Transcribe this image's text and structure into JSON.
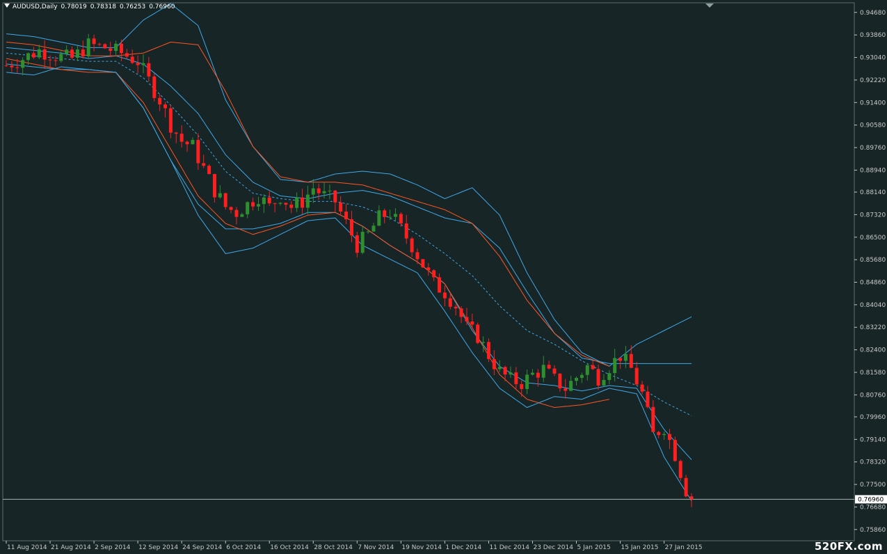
{
  "header": {
    "symbol": "AUDUSD,Daily",
    "open": "0.78019",
    "high": "0.78318",
    "low": "0.76253",
    "close": "0.76960"
  },
  "watermark": "520FX.com",
  "colors": {
    "background": "#172526",
    "bull_candle": "#2f8f2f",
    "bear_candle": "#ff1f1f",
    "inner_band": "#3fa9e8",
    "outer_band": "#ff5522",
    "midline": "#3fa9e8",
    "axis": "#c8c8c8",
    "price_line": "#aab4b4"
  },
  "chart_data": {
    "type": "candlestick",
    "symbol": "AUDUSD",
    "timeframe": "Daily",
    "ylim": [
      0.7545,
      0.9503
    ],
    "y_ticks": [
      "0.94680",
      "0.93860",
      "0.93040",
      "0.92220",
      "0.91400",
      "0.90580",
      "0.89760",
      "0.88940",
      "0.88140",
      "0.87320",
      "0.86500",
      "0.85680",
      "0.84860",
      "0.84040",
      "0.83220",
      "0.82400",
      "0.81580",
      "0.80760",
      "0.79960",
      "0.79140",
      "0.78320",
      "0.77500",
      "0.76680",
      "0.75860"
    ],
    "current_price_label": "0.76960",
    "current_price": 0.7696,
    "x_labels": [
      "11 Aug 2014",
      "21 Aug 2014",
      "2 Sep 2014",
      "12 Sep 2014",
      "24 Sep 2014",
      "6 Oct 2014",
      "16 Oct 2014",
      "28 Oct 2014",
      "7 Nov 2014",
      "19 Nov 2014",
      "1 Dec 2014",
      "11 Dec 2014",
      "23 Dec 2014",
      "5 Jan 2015",
      "15 Jan 2015",
      "27 Jan 2015"
    ],
    "x_label_bar_index": [
      0,
      8,
      16,
      24,
      32,
      40,
      48,
      56,
      64,
      72,
      80,
      88,
      96,
      104,
      112,
      120
    ],
    "bar_count": 126,
    "series": [
      {
        "kind": "band-inner-upper",
        "points": [
          [
            0,
            0.939
          ],
          [
            5,
            0.938
          ],
          [
            10,
            0.936
          ],
          [
            15,
            0.934
          ],
          [
            20,
            0.934
          ],
          [
            25,
            0.944
          ],
          [
            30,
            0.95
          ],
          [
            35,
            0.942
          ],
          [
            40,
            0.915
          ],
          [
            45,
            0.898
          ],
          [
            50,
            0.886
          ],
          [
            55,
            0.885
          ],
          [
            60,
            0.888
          ],
          [
            65,
            0.889
          ],
          [
            70,
            0.888
          ],
          [
            75,
            0.884
          ],
          [
            80,
            0.879
          ],
          [
            85,
            0.883
          ],
          [
            90,
            0.873
          ],
          [
            95,
            0.852
          ],
          [
            100,
            0.835
          ],
          [
            105,
            0.823
          ],
          [
            110,
            0.818
          ],
          [
            115,
            0.826
          ],
          [
            120,
            0.831
          ],
          [
            125,
            0.836
          ]
        ]
      },
      {
        "kind": "band-inner-mid",
        "points": [
          [
            0,
            0.934
          ],
          [
            5,
            0.933
          ],
          [
            10,
            0.932
          ],
          [
            15,
            0.93
          ],
          [
            20,
            0.931
          ],
          [
            25,
            0.928
          ],
          [
            30,
            0.92
          ],
          [
            35,
            0.91
          ],
          [
            40,
            0.895
          ],
          [
            45,
            0.885
          ],
          [
            50,
            0.88
          ],
          [
            55,
            0.879
          ],
          [
            60,
            0.881
          ],
          [
            65,
            0.882
          ],
          [
            70,
            0.88
          ],
          [
            75,
            0.876
          ],
          [
            80,
            0.872
          ],
          [
            85,
            0.87
          ],
          [
            90,
            0.861
          ],
          [
            95,
            0.845
          ],
          [
            100,
            0.83
          ],
          [
            105,
            0.821
          ],
          [
            110,
            0.819
          ],
          [
            115,
            0.819
          ],
          [
            120,
            0.819
          ],
          [
            125,
            0.819
          ]
        ]
      },
      {
        "kind": "midline",
        "points": [
          [
            0,
            0.932
          ],
          [
            5,
            0.931
          ],
          [
            10,
            0.93
          ],
          [
            15,
            0.929
          ],
          [
            20,
            0.929
          ],
          [
            25,
            0.923
          ],
          [
            30,
            0.913
          ],
          [
            35,
            0.902
          ],
          [
            40,
            0.889
          ],
          [
            45,
            0.881
          ],
          [
            50,
            0.879
          ],
          [
            55,
            0.878
          ],
          [
            60,
            0.878
          ],
          [
            65,
            0.876
          ],
          [
            70,
            0.872
          ],
          [
            75,
            0.866
          ],
          [
            80,
            0.859
          ],
          [
            85,
            0.851
          ],
          [
            90,
            0.84
          ],
          [
            95,
            0.831
          ],
          [
            100,
            0.826
          ],
          [
            105,
            0.82
          ],
          [
            110,
            0.815
          ],
          [
            115,
            0.811
          ],
          [
            120,
            0.805
          ],
          [
            125,
            0.8
          ]
        ]
      },
      {
        "kind": "band-inner-lower",
        "points": [
          [
            0,
            0.928
          ],
          [
            5,
            0.927
          ],
          [
            10,
            0.926
          ],
          [
            15,
            0.926
          ],
          [
            20,
            0.925
          ],
          [
            25,
            0.912
          ],
          [
            30,
            0.893
          ],
          [
            35,
            0.877
          ],
          [
            40,
            0.868
          ],
          [
            45,
            0.868
          ],
          [
            50,
            0.87
          ],
          [
            55,
            0.874
          ],
          [
            60,
            0.874
          ],
          [
            65,
            0.869
          ],
          [
            70,
            0.862
          ],
          [
            75,
            0.856
          ],
          [
            80,
            0.848
          ],
          [
            85,
            0.831
          ],
          [
            90,
            0.818
          ],
          [
            95,
            0.812
          ],
          [
            100,
            0.811
          ],
          [
            105,
            0.809
          ],
          [
            110,
            0.811
          ],
          [
            115,
            0.81
          ],
          [
            120,
            0.795
          ],
          [
            125,
            0.784
          ]
        ]
      },
      {
        "kind": "band-outer-upper",
        "points": [
          [
            0,
            0.936
          ],
          [
            5,
            0.935
          ],
          [
            10,
            0.933
          ],
          [
            15,
            0.931
          ],
          [
            20,
            0.931
          ],
          [
            25,
            0.932
          ],
          [
            30,
            0.936
          ],
          [
            35,
            0.935
          ],
          [
            40,
            0.918
          ],
          [
            45,
            0.898
          ],
          [
            50,
            0.887
          ],
          [
            55,
            0.885
          ],
          [
            60,
            0.885
          ],
          [
            65,
            0.884
          ],
          [
            70,
            0.881
          ],
          [
            75,
            0.878
          ],
          [
            80,
            0.875
          ],
          [
            85,
            0.87
          ],
          [
            90,
            0.858
          ],
          [
            95,
            0.842
          ],
          [
            100,
            0.83
          ],
          [
            105,
            0.822
          ],
          [
            110,
            0.818
          ]
        ]
      },
      {
        "kind": "band-outer-lower",
        "points": [
          [
            0,
            0.93
          ],
          [
            5,
            0.928
          ],
          [
            10,
            0.926
          ],
          [
            15,
            0.925
          ],
          [
            20,
            0.925
          ],
          [
            25,
            0.914
          ],
          [
            30,
            0.897
          ],
          [
            35,
            0.88
          ],
          [
            40,
            0.87
          ],
          [
            45,
            0.866
          ],
          [
            50,
            0.869
          ],
          [
            55,
            0.873
          ],
          [
            60,
            0.874
          ],
          [
            65,
            0.869
          ],
          [
            70,
            0.862
          ],
          [
            75,
            0.856
          ],
          [
            80,
            0.848
          ],
          [
            85,
            0.832
          ],
          [
            90,
            0.815
          ],
          [
            95,
            0.806
          ],
          [
            100,
            0.803
          ],
          [
            105,
            0.804
          ],
          [
            110,
            0.806
          ]
        ]
      },
      {
        "kind": "band-outer-lower-2",
        "points": [
          [
            0,
            0.925
          ],
          [
            5,
            0.924
          ],
          [
            10,
            0.927
          ],
          [
            15,
            0.926
          ],
          [
            20,
            0.925
          ],
          [
            25,
            0.912
          ],
          [
            30,
            0.893
          ],
          [
            35,
            0.873
          ],
          [
            40,
            0.859
          ],
          [
            45,
            0.861
          ],
          [
            50,
            0.866
          ],
          [
            55,
            0.871
          ],
          [
            60,
            0.872
          ],
          [
            65,
            0.862
          ],
          [
            70,
            0.857
          ],
          [
            75,
            0.852
          ],
          [
            80,
            0.838
          ],
          [
            85,
            0.823
          ],
          [
            90,
            0.81
          ],
          [
            95,
            0.803
          ],
          [
            100,
            0.807
          ],
          [
            105,
            0.806
          ],
          [
            110,
            0.81
          ],
          [
            115,
            0.808
          ],
          [
            120,
            0.785
          ],
          [
            125,
            0.769
          ]
        ]
      }
    ],
    "candle_path": [
      [
        0,
        0.9275
      ],
      [
        3,
        0.93
      ],
      [
        6,
        0.933
      ],
      [
        9,
        0.931
      ],
      [
        12,
        0.93
      ],
      [
        15,
        0.935
      ],
      [
        18,
        0.934
      ],
      [
        21,
        0.932
      ],
      [
        24,
        0.929
      ],
      [
        26,
        0.922
      ],
      [
        28,
        0.915
      ],
      [
        30,
        0.906
      ],
      [
        32,
        0.9
      ],
      [
        34,
        0.898
      ],
      [
        36,
        0.89
      ],
      [
        38,
        0.882
      ],
      [
        40,
        0.876
      ],
      [
        42,
        0.874
      ],
      [
        44,
        0.877
      ],
      [
        46,
        0.88
      ],
      [
        48,
        0.876
      ],
      [
        50,
        0.88
      ],
      [
        52,
        0.876
      ],
      [
        54,
        0.878
      ],
      [
        56,
        0.883
      ],
      [
        58,
        0.88
      ],
      [
        60,
        0.878
      ],
      [
        62,
        0.87
      ],
      [
        64,
        0.862
      ],
      [
        66,
        0.866
      ],
      [
        68,
        0.872
      ],
      [
        70,
        0.874
      ],
      [
        72,
        0.868
      ],
      [
        74,
        0.862
      ],
      [
        76,
        0.855
      ],
      [
        78,
        0.848
      ],
      [
        80,
        0.845
      ],
      [
        82,
        0.84
      ],
      [
        84,
        0.832
      ],
      [
        86,
        0.829
      ],
      [
        88,
        0.822
      ],
      [
        90,
        0.816
      ],
      [
        92,
        0.813
      ],
      [
        94,
        0.812
      ],
      [
        96,
        0.815
      ],
      [
        98,
        0.817
      ],
      [
        100,
        0.813
      ],
      [
        102,
        0.81
      ],
      [
        104,
        0.814
      ],
      [
        106,
        0.818
      ],
      [
        108,
        0.814
      ],
      [
        110,
        0.818
      ],
      [
        112,
        0.822
      ],
      [
        114,
        0.817
      ],
      [
        116,
        0.808
      ],
      [
        118,
        0.793
      ],
      [
        120,
        0.796
      ],
      [
        122,
        0.786
      ],
      [
        124,
        0.773
      ],
      [
        125,
        0.7696
      ]
    ]
  }
}
